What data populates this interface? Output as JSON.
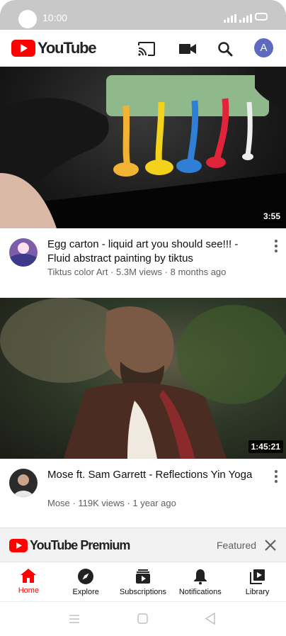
{
  "status_bar": {
    "time": "10:00"
  },
  "app_bar": {
    "logo_text": "YouTube",
    "cast_icon": "cast-icon",
    "camera_icon": "video-camera-icon",
    "search_icon": "search-icon",
    "avatar_letter": "A"
  },
  "videos": [
    {
      "title": "Egg carton - liquid art you should see!!! - Fluid abstract painting by tiktus",
      "subtitle": "Tiktus color Art · 5.3M views · 8 months ago",
      "duration": "3:55"
    },
    {
      "title": "Mose ft. Sam Garrett - Reflections Yin Yoga",
      "subtitle": "Mose · 119K views · 1 year ago",
      "duration": "1:45:21"
    }
  ],
  "premium_banner": {
    "logo_text": "YouTube Premium",
    "label": "Featured"
  },
  "bottom_nav": [
    {
      "label": "Home",
      "icon": "home-icon"
    },
    {
      "label": "Explore",
      "icon": "compass-icon"
    },
    {
      "label": "Subscriptions",
      "icon": "subscriptions-icon"
    },
    {
      "label": "Notifications",
      "icon": "bell-icon"
    },
    {
      "label": "Library",
      "icon": "library-icon"
    }
  ],
  "colors": {
    "brand_red": "#ff0000",
    "avatar_bg": "#5c6bc0",
    "status_bar": "#c8c8c8"
  }
}
